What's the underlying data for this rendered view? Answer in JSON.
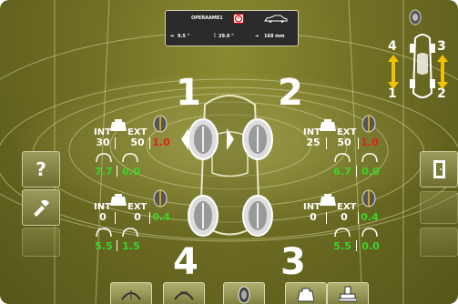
{
  "infobar": {
    "title": "OPERAAME1",
    "camber_value": "9.5 \"",
    "caster_value": "29.0 \"",
    "toe_value": "168 mm",
    "caster_symbol": "|",
    "toe_arrow": "➜"
  },
  "wheel_numbers": [
    "1",
    "2",
    "3",
    "4"
  ],
  "mini_legend": {
    "front_left": "4",
    "front_right": "3",
    "rear_left": "1",
    "rear_right": "2"
  },
  "wheels": {
    "front_left": {
      "int_label": "INT",
      "ext_label": "EXT",
      "int_value": "30",
      "ext_value": "50",
      "diff_value": "1.0",
      "diff_color": "#e32020",
      "left_reading": "7.7",
      "right_reading": "0.0"
    },
    "front_right": {
      "int_label": "INT",
      "ext_label": "EXT",
      "int_value": "25",
      "ext_value": "50",
      "diff_value": "1.0",
      "diff_color": "#e32020",
      "left_reading": "6.7",
      "right_reading": "0.0"
    },
    "rear_left": {
      "int_label": "INT",
      "ext_label": "EXT",
      "int_value": "0",
      "ext_value": "0",
      "diff_value": "0.4",
      "diff_color": "#39d629",
      "left_reading": "5.5",
      "right_reading": "1.5"
    },
    "rear_right": {
      "int_label": "INT",
      "ext_label": "EXT",
      "int_value": "0",
      "ext_value": "0",
      "diff_value": "0.4",
      "diff_color": "#39d629",
      "left_reading": "5.5",
      "right_reading": "0.0"
    }
  },
  "side_buttons": {
    "help": "?"
  },
  "colors": {
    "accent": "#e32020",
    "ok": "#39d629",
    "arrow": "#f2c200"
  }
}
